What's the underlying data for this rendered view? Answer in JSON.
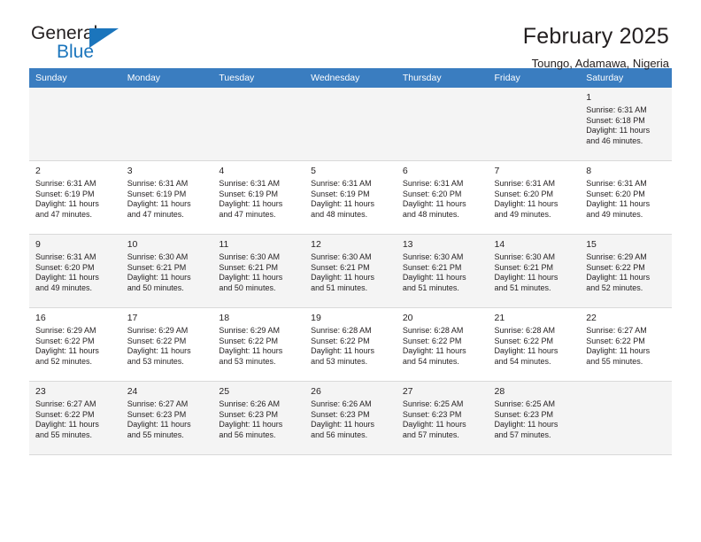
{
  "brand": {
    "name_part1": "General",
    "name_part2": "Blue",
    "logo_icon": "triangle-logo-icon"
  },
  "header": {
    "title": "February 2025",
    "location": "Toungo, Adamawa, Nigeria"
  },
  "colors": {
    "header_row_bg": "#3A7DC0",
    "brand_blue": "#1B75BC",
    "shaded_row_bg": "#F4F4F4",
    "text": "#231F20",
    "grid_line": "#D9D9D9"
  },
  "calendar": {
    "weekday_headers": [
      "Sunday",
      "Monday",
      "Tuesday",
      "Wednesday",
      "Thursday",
      "Friday",
      "Saturday"
    ],
    "weeks": [
      [
        {
          "day": "",
          "lines": [],
          "empty": true
        },
        {
          "day": "",
          "lines": [],
          "empty": true
        },
        {
          "day": "",
          "lines": [],
          "empty": true
        },
        {
          "day": "",
          "lines": [],
          "empty": true
        },
        {
          "day": "",
          "lines": [],
          "empty": true
        },
        {
          "day": "",
          "lines": [],
          "empty": true
        },
        {
          "day": "1",
          "lines": [
            "Sunrise: 6:31 AM",
            "Sunset: 6:18 PM",
            "Daylight: 11 hours",
            "and 46 minutes."
          ],
          "empty": false
        }
      ],
      [
        {
          "day": "2",
          "lines": [
            "Sunrise: 6:31 AM",
            "Sunset: 6:19 PM",
            "Daylight: 11 hours",
            "and 47 minutes."
          ],
          "empty": false
        },
        {
          "day": "3",
          "lines": [
            "Sunrise: 6:31 AM",
            "Sunset: 6:19 PM",
            "Daylight: 11 hours",
            "and 47 minutes."
          ],
          "empty": false
        },
        {
          "day": "4",
          "lines": [
            "Sunrise: 6:31 AM",
            "Sunset: 6:19 PM",
            "Daylight: 11 hours",
            "and 47 minutes."
          ],
          "empty": false
        },
        {
          "day": "5",
          "lines": [
            "Sunrise: 6:31 AM",
            "Sunset: 6:19 PM",
            "Daylight: 11 hours",
            "and 48 minutes."
          ],
          "empty": false
        },
        {
          "day": "6",
          "lines": [
            "Sunrise: 6:31 AM",
            "Sunset: 6:20 PM",
            "Daylight: 11 hours",
            "and 48 minutes."
          ],
          "empty": false
        },
        {
          "day": "7",
          "lines": [
            "Sunrise: 6:31 AM",
            "Sunset: 6:20 PM",
            "Daylight: 11 hours",
            "and 49 minutes."
          ],
          "empty": false
        },
        {
          "day": "8",
          "lines": [
            "Sunrise: 6:31 AM",
            "Sunset: 6:20 PM",
            "Daylight: 11 hours",
            "and 49 minutes."
          ],
          "empty": false
        }
      ],
      [
        {
          "day": "9",
          "lines": [
            "Sunrise: 6:31 AM",
            "Sunset: 6:20 PM",
            "Daylight: 11 hours",
            "and 49 minutes."
          ],
          "empty": false
        },
        {
          "day": "10",
          "lines": [
            "Sunrise: 6:30 AM",
            "Sunset: 6:21 PM",
            "Daylight: 11 hours",
            "and 50 minutes."
          ],
          "empty": false
        },
        {
          "day": "11",
          "lines": [
            "Sunrise: 6:30 AM",
            "Sunset: 6:21 PM",
            "Daylight: 11 hours",
            "and 50 minutes."
          ],
          "empty": false
        },
        {
          "day": "12",
          "lines": [
            "Sunrise: 6:30 AM",
            "Sunset: 6:21 PM",
            "Daylight: 11 hours",
            "and 51 minutes."
          ],
          "empty": false
        },
        {
          "day": "13",
          "lines": [
            "Sunrise: 6:30 AM",
            "Sunset: 6:21 PM",
            "Daylight: 11 hours",
            "and 51 minutes."
          ],
          "empty": false
        },
        {
          "day": "14",
          "lines": [
            "Sunrise: 6:30 AM",
            "Sunset: 6:21 PM",
            "Daylight: 11 hours",
            "and 51 minutes."
          ],
          "empty": false
        },
        {
          "day": "15",
          "lines": [
            "Sunrise: 6:29 AM",
            "Sunset: 6:22 PM",
            "Daylight: 11 hours",
            "and 52 minutes."
          ],
          "empty": false
        }
      ],
      [
        {
          "day": "16",
          "lines": [
            "Sunrise: 6:29 AM",
            "Sunset: 6:22 PM",
            "Daylight: 11 hours",
            "and 52 minutes."
          ],
          "empty": false
        },
        {
          "day": "17",
          "lines": [
            "Sunrise: 6:29 AM",
            "Sunset: 6:22 PM",
            "Daylight: 11 hours",
            "and 53 minutes."
          ],
          "empty": false
        },
        {
          "day": "18",
          "lines": [
            "Sunrise: 6:29 AM",
            "Sunset: 6:22 PM",
            "Daylight: 11 hours",
            "and 53 minutes."
          ],
          "empty": false
        },
        {
          "day": "19",
          "lines": [
            "Sunrise: 6:28 AM",
            "Sunset: 6:22 PM",
            "Daylight: 11 hours",
            "and 53 minutes."
          ],
          "empty": false
        },
        {
          "day": "20",
          "lines": [
            "Sunrise: 6:28 AM",
            "Sunset: 6:22 PM",
            "Daylight: 11 hours",
            "and 54 minutes."
          ],
          "empty": false
        },
        {
          "day": "21",
          "lines": [
            "Sunrise: 6:28 AM",
            "Sunset: 6:22 PM",
            "Daylight: 11 hours",
            "and 54 minutes."
          ],
          "empty": false
        },
        {
          "day": "22",
          "lines": [
            "Sunrise: 6:27 AM",
            "Sunset: 6:22 PM",
            "Daylight: 11 hours",
            "and 55 minutes."
          ],
          "empty": false
        }
      ],
      [
        {
          "day": "23",
          "lines": [
            "Sunrise: 6:27 AM",
            "Sunset: 6:22 PM",
            "Daylight: 11 hours",
            "and 55 minutes."
          ],
          "empty": false
        },
        {
          "day": "24",
          "lines": [
            "Sunrise: 6:27 AM",
            "Sunset: 6:23 PM",
            "Daylight: 11 hours",
            "and 55 minutes."
          ],
          "empty": false
        },
        {
          "day": "25",
          "lines": [
            "Sunrise: 6:26 AM",
            "Sunset: 6:23 PM",
            "Daylight: 11 hours",
            "and 56 minutes."
          ],
          "empty": false
        },
        {
          "day": "26",
          "lines": [
            "Sunrise: 6:26 AM",
            "Sunset: 6:23 PM",
            "Daylight: 11 hours",
            "and 56 minutes."
          ],
          "empty": false
        },
        {
          "day": "27",
          "lines": [
            "Sunrise: 6:25 AM",
            "Sunset: 6:23 PM",
            "Daylight: 11 hours",
            "and 57 minutes."
          ],
          "empty": false
        },
        {
          "day": "28",
          "lines": [
            "Sunrise: 6:25 AM",
            "Sunset: 6:23 PM",
            "Daylight: 11 hours",
            "and 57 minutes."
          ],
          "empty": false
        },
        {
          "day": "",
          "lines": [],
          "empty": true
        }
      ]
    ]
  }
}
